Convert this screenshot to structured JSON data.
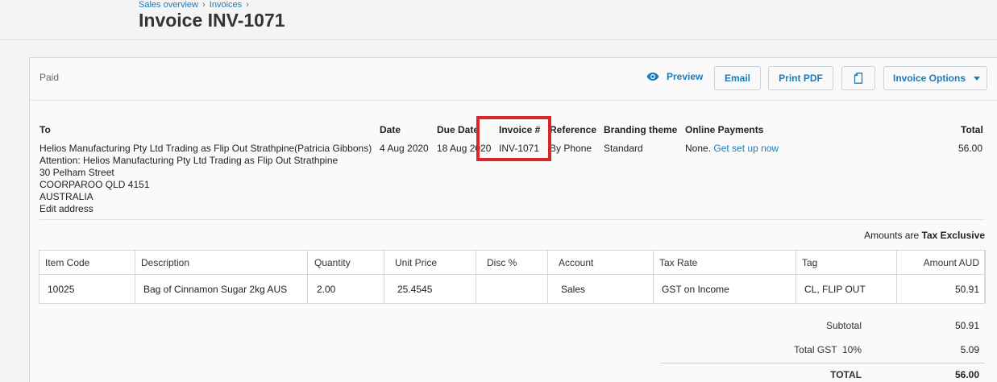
{
  "breadcrumb": {
    "items": [
      "Sales overview",
      "Invoices"
    ],
    "sep": "›"
  },
  "page_title": "Invoice INV-1071",
  "status": "Paid",
  "toolbar": {
    "preview_label": "Preview",
    "email_label": "Email",
    "print_label": "Print PDF",
    "options_label": "Invoice Options"
  },
  "details": {
    "headers": {
      "to": "To",
      "date": "Date",
      "due": "Due Date",
      "invoice": "Invoice #",
      "reference": "Reference",
      "branding": "Branding theme",
      "online": "Online Payments",
      "total": "Total"
    },
    "to_link": "Helios Manufacturing Pty Ltd Trading as Flip Out Strathpine(Patricia Gibbons)",
    "address": [
      "Attention: Helios Manufacturing Pty Ltd Trading as Flip Out Strathpine",
      "30 Pelham Street",
      "COORPAROO QLD 4151",
      "AUSTRALIA"
    ],
    "edit_address": "Edit address",
    "date": "4 Aug 2020",
    "due_date": "18 Aug 2020",
    "invoice_no": "INV-1071",
    "reference": "By Phone",
    "branding": "Standard",
    "online_none": "None.",
    "online_setup": "Get set up now",
    "total": "56.00"
  },
  "amounts_are": {
    "prefix": "Amounts are",
    "mode": "Tax Exclusive"
  },
  "table": {
    "headers": [
      "Item Code",
      "Description",
      "Quantity",
      "Unit Price",
      "Disc %",
      "Account",
      "Tax Rate",
      "Tag",
      "Amount AUD"
    ],
    "rows": [
      [
        "10025",
        "Bag of Cinnamon Sugar 2kg AUS",
        "2.00",
        "25.4545",
        "",
        "Sales",
        "GST on Income",
        "CL, FLIP OUT",
        "50.91"
      ]
    ]
  },
  "totals": {
    "subtotal_label": "Subtotal",
    "subtotal": "50.91",
    "gst_label": "Total GST  10%",
    "gst": "5.09",
    "total_label": "TOTAL",
    "total": "56.00"
  },
  "colors": {
    "link": "#1a7dbb",
    "highlight": "#d9262c"
  }
}
